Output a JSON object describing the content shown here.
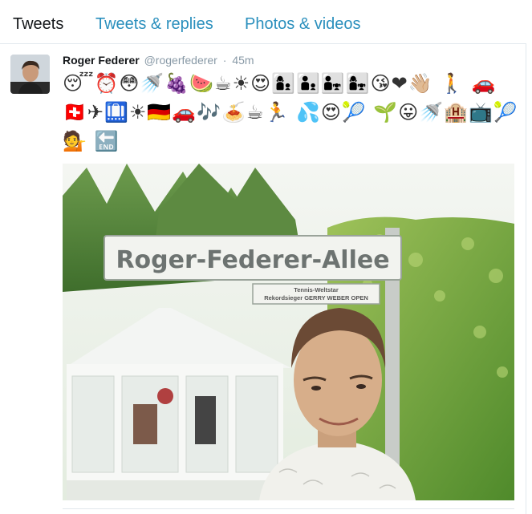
{
  "tabs": [
    {
      "label": "Tweets",
      "active": true
    },
    {
      "label": "Tweets & replies",
      "active": false
    },
    {
      "label": "Photos & videos",
      "active": false
    }
  ],
  "tweet": {
    "name": "Roger Federer",
    "handle": "@rogerfederer",
    "separator": "·",
    "time": "45m",
    "emoji_text": "😴⏰😳🚿🍇🍉☕☀😍👩‍👦👨‍👦👨‍👧👩‍👧😘❤👋🏼 🚶 🚗🇨🇭✈🛄☀🇩🇪🚗🎶🍝☕🏃 💦😍🎾 🌱😛🚿🏨📺🎾💁 🔚",
    "photo": {
      "sign_main": "Roger-Federer-Allee",
      "sign_sub_line1": "Tennis-Weltstar",
      "sign_sub_line2": "Rekordsieger GERRY WEBER OPEN"
    }
  },
  "colors": {
    "link": "#2a8fbd",
    "secondary_text": "#8899a6",
    "divider": "#e1e8ed"
  },
  "icons": {
    "avatar": "profile-photo"
  }
}
